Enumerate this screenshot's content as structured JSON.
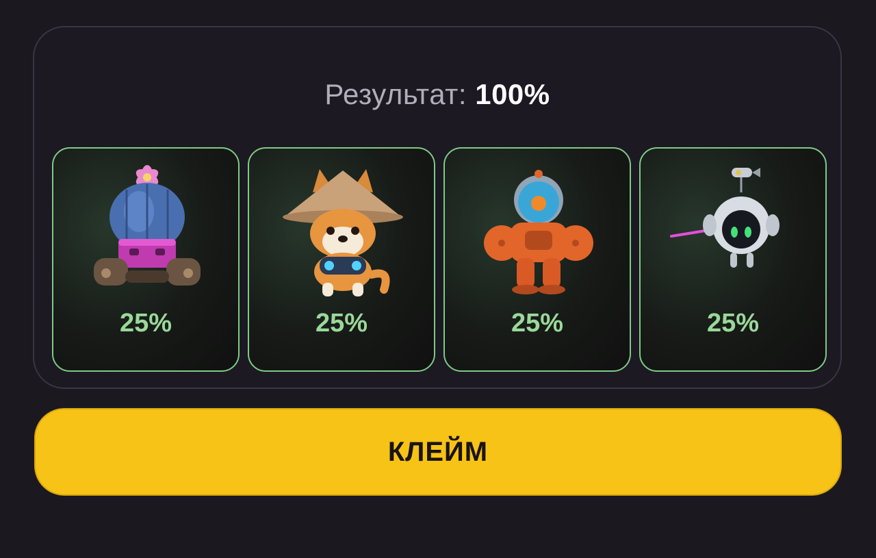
{
  "result": {
    "label": "Результат:",
    "value": "100%"
  },
  "cards": [
    {
      "icon": "cactus-tank-icon",
      "percent": "25%"
    },
    {
      "icon": "shiba-dog-icon",
      "percent": "25%"
    },
    {
      "icon": "orange-robot-icon",
      "percent": "25%"
    },
    {
      "icon": "drone-bot-icon",
      "percent": "25%"
    }
  ],
  "claim_button": {
    "label": "КЛЕЙМ"
  },
  "colors": {
    "accent_green": "#9ad89a",
    "card_border": "#7ecb86",
    "button_yellow": "#f6c316"
  }
}
